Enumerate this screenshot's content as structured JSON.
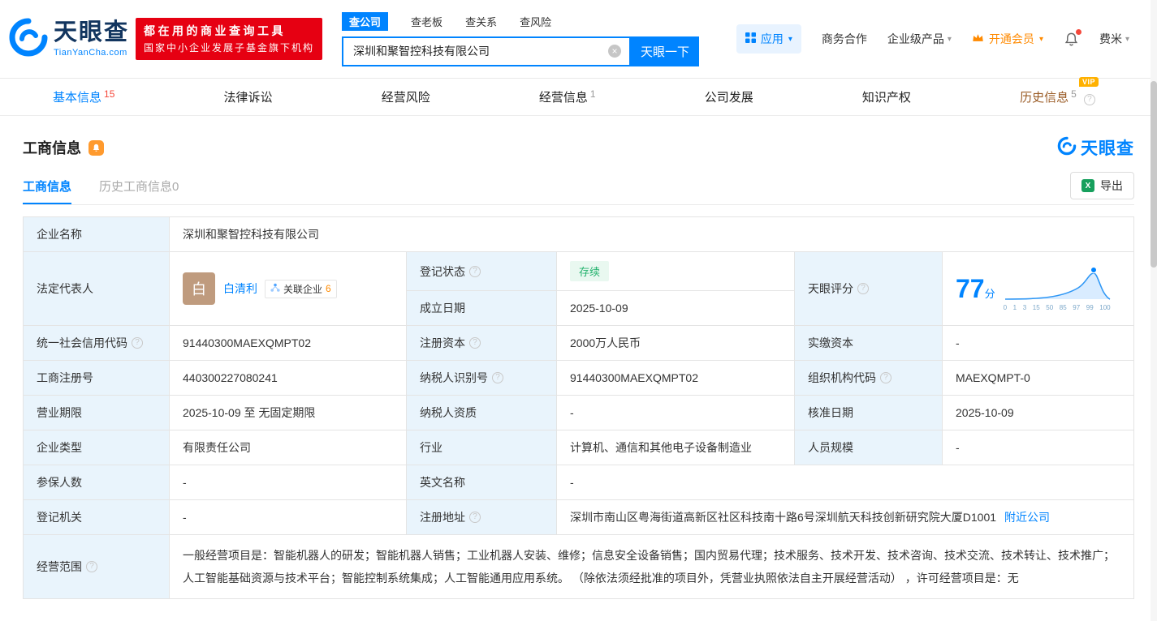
{
  "brand": {
    "name": "天眼查",
    "domain": "TianYanCha.com",
    "tagline1": "都在用的商业查询工具",
    "tagline2": "国家中小企业发展子基金旗下机构"
  },
  "search": {
    "tabs": [
      "查公司",
      "查老板",
      "查关系",
      "查风险"
    ],
    "value": "深圳和聚智控科技有限公司",
    "button": "天眼一下"
  },
  "topnav": {
    "app": "应用",
    "coop": "商务合作",
    "enterprise": "企业级产品",
    "vip": "开通会员",
    "user": "费米"
  },
  "tabs": [
    {
      "label": "基本信息",
      "count": "15"
    },
    {
      "label": "法律诉讼",
      "count": ""
    },
    {
      "label": "经营风险",
      "count": ""
    },
    {
      "label": "经营信息",
      "count": "1"
    },
    {
      "label": "公司发展",
      "count": ""
    },
    {
      "label": "知识产权",
      "count": ""
    },
    {
      "label": "历史信息",
      "count": "5"
    }
  ],
  "icons": {
    "caret_down": "▾",
    "help": "?",
    "clear": "×",
    "vip_badge": "VIP",
    "excel": "X"
  },
  "section": {
    "title": "工商信息",
    "watermark": "天眼查",
    "subtab1": "工商信息",
    "subtab2": "历史工商信息0",
    "export": "导出"
  },
  "info": {
    "company_name_label": "企业名称",
    "company_name": "深圳和聚智控科技有限公司",
    "legal_rep_label": "法定代表人",
    "avatar_char": "白",
    "legal_rep_name": "白清利",
    "related_company_label": "关联企业",
    "related_company_count": "6",
    "reg_status_label": "登记状态",
    "reg_status_value": "存续",
    "establish_date_label": "成立日期",
    "establish_date_value": "2025-10-09",
    "score_label": "天眼评分",
    "score_value": "77",
    "score_unit": "分",
    "score_axis": [
      "0",
      "1",
      "3",
      "15",
      "50",
      "85",
      "97",
      "99",
      "100"
    ],
    "credit_code_label": "统一社会信用代码",
    "credit_code_value": "91440300MAEXQMPT02",
    "reg_capital_label": "注册资本",
    "reg_capital_value": "2000万人民币",
    "paid_capital_label": "实缴资本",
    "paid_capital_value": "-",
    "reg_number_label": "工商注册号",
    "reg_number_value": "440300227080241",
    "taxpayer_id_label": "纳税人识别号",
    "taxpayer_id_value": "91440300MAEXQMPT02",
    "org_code_label": "组织机构代码",
    "org_code_value": "MAEXQMPT-0",
    "business_term_label": "营业期限",
    "business_term_value": "2025-10-09 至 无固定期限",
    "taxpayer_quality_label": "纳税人资质",
    "taxpayer_quality_value": "-",
    "approval_date_label": "核准日期",
    "approval_date_value": "2025-10-09",
    "company_type_label": "企业类型",
    "company_type_value": "有限责任公司",
    "industry_label": "行业",
    "industry_value": "计算机、通信和其他电子设备制造业",
    "staff_size_label": "人员规模",
    "staff_size_value": "-",
    "insured_label": "参保人数",
    "insured_value": "-",
    "english_name_label": "英文名称",
    "english_name_value": "-",
    "reg_authority_label": "登记机关",
    "reg_authority_value": "-",
    "address_label": "注册地址",
    "address_value": "深圳市南山区粤海街道高新区社区科技南十路6号深圳航天科技创新研究院大厦D1001",
    "nearby_link": "附近公司",
    "business_scope_label": "经营范围",
    "business_scope_value": "一般经营项目是：智能机器人的研发；智能机器人销售；工业机器人安装、维修；信息安全设备销售；国内贸易代理；技术服务、技术开发、技术咨询、技术交流、技术转让、技术推广；人工智能基础资源与技术平台；智能控制系统集成；人工智能通用应用系统。 （除依法须经批准的项目外，凭营业执照依法自主开展经营活动） ，许可经营项目是：无"
  }
}
